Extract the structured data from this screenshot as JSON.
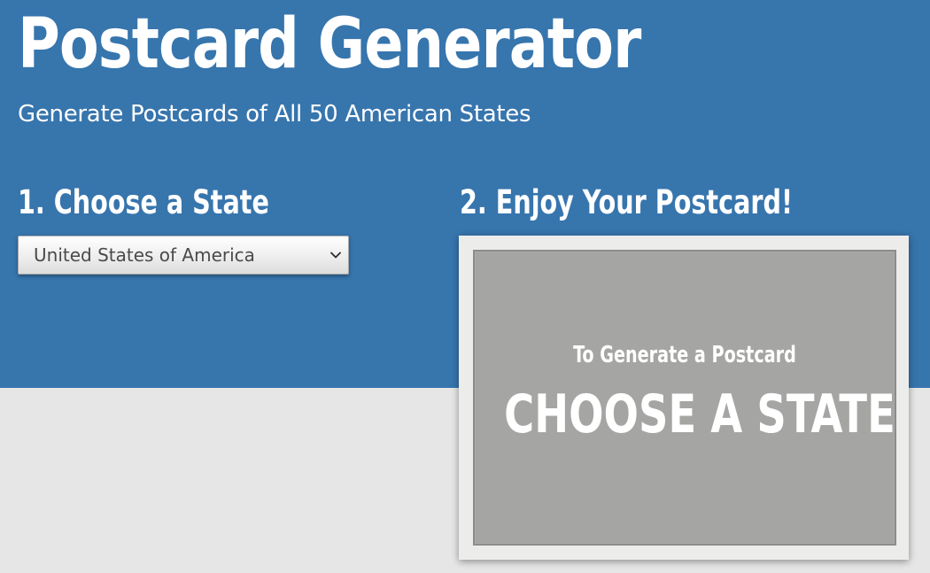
{
  "header": {
    "title": "Postcard Generator",
    "subtitle": "Generate Postcards of All 50 American States"
  },
  "steps": {
    "choose_heading": "1. Choose a State",
    "enjoy_heading": "2. Enjoy Your Postcard!"
  },
  "state_select": {
    "selected": "United States of America",
    "icon": "chevron-down-icon"
  },
  "postcard": {
    "line1": "To Generate a Postcard",
    "line2": "CHOOSE A STATE"
  },
  "colors": {
    "header_background": "#3775ad",
    "page_background": "#e6e6e6",
    "postcard_frame": "#ececeb",
    "postcard_face": "#a5a5a3",
    "text": "#ffffff"
  }
}
